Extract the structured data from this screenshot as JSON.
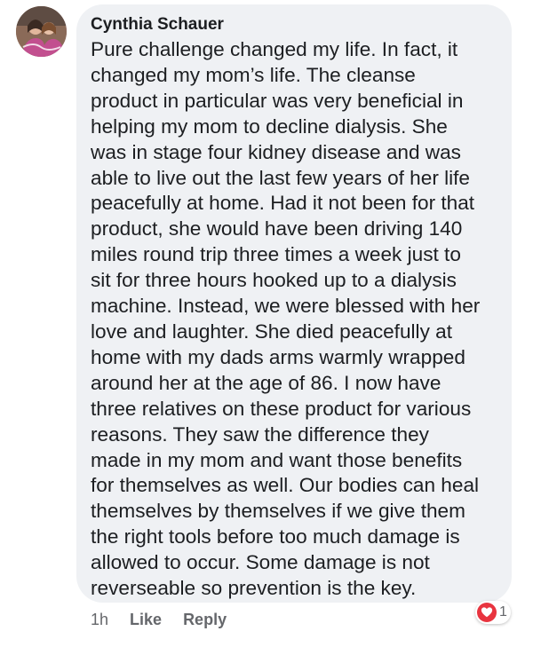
{
  "comment": {
    "author": "Cynthia Schauer",
    "lines": [
      "Pure challenge changed my life. In fact, it",
      "changed my mom’s life. The cleanse",
      "product in particular was very beneficial in",
      "helping my mom to decline dialysis. She",
      "was in stage four kidney disease and was",
      "able to live out the last few years of her life",
      "peacefully at home. Had it not been for that",
      "product, she would have been driving 140",
      "miles round trip three times a week just to",
      "sit for three hours hooked up to a dialysis",
      "machine. Instead, we were blessed with her",
      "love and laughter. She died peacefully at",
      "home with my dads arms warmly wrapped",
      "around her at the age of 86. I now have",
      "three relatives on these product for various",
      "reasons. They saw the difference they",
      "made in my mom and want those benefits",
      "for themselves as well. Our bodies can heal",
      "themselves by themselves if we give them",
      "the right tools before too much damage is",
      "allowed to occur. Some damage is not",
      "reverseable so prevention is the key."
    ]
  },
  "actions": {
    "time": "1h",
    "like_label": "Like",
    "reply_label": "Reply"
  },
  "reactions": {
    "icon": "heart-icon",
    "count": "1",
    "color": "#e8343f"
  },
  "colors": {
    "bubble": "#eff1f4",
    "text": "#1c1e21",
    "meta": "#65676b"
  }
}
